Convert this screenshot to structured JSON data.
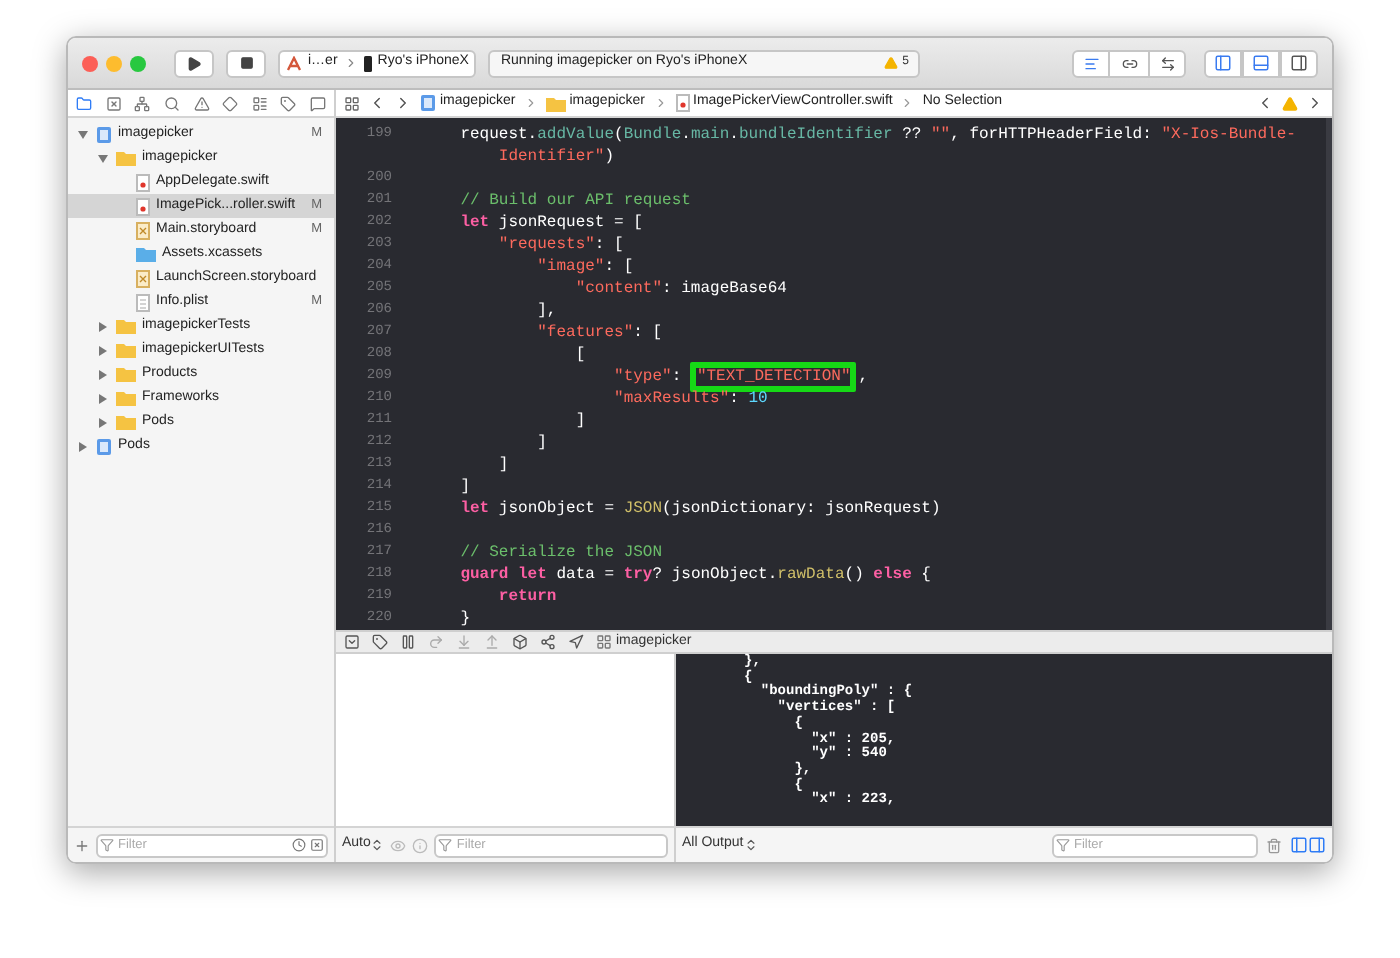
{
  "toolbar": {
    "scheme": {
      "app": "i…er",
      "device": "Ryo's iPhoneX"
    },
    "status": "Running imagepicker on Ryo's iPhoneX",
    "warnings": "5",
    "panels": [
      {
        "kind": "navigator",
        "on": true
      },
      {
        "kind": "debug",
        "on": true
      },
      {
        "kind": "inspector",
        "on": false
      }
    ]
  },
  "navigator_tabs": [
    {
      "kind": "files",
      "selected": true
    },
    {
      "kind": "source",
      "selected": false
    },
    {
      "kind": "symbols",
      "selected": false
    },
    {
      "kind": "search",
      "selected": false
    },
    {
      "kind": "issues",
      "selected": false
    },
    {
      "kind": "tests",
      "selected": false
    },
    {
      "kind": "debug",
      "selected": false
    },
    {
      "kind": "breakpoints",
      "selected": false
    },
    {
      "kind": "reports",
      "selected": false
    }
  ],
  "tree": [
    {
      "label": "imagepicker",
      "kind": "project",
      "status": "M",
      "selected": false,
      "expanded": true,
      "children": [
        {
          "label": "imagepicker",
          "kind": "folder",
          "selected": false,
          "expanded": true,
          "children": [
            {
              "label": "AppDelegate.swift",
              "kind": "swift",
              "selected": false
            },
            {
              "label": "ImagePick...roller.swift",
              "kind": "swift",
              "status": "M",
              "selected": true
            },
            {
              "label": "Main.storyboard",
              "kind": "storyboard",
              "status": "M",
              "selected": false
            },
            {
              "label": "Assets.xcassets",
              "kind": "assets",
              "selected": false
            },
            {
              "label": "LaunchScreen.storyboard",
              "kind": "storyboard",
              "selected": false
            },
            {
              "label": "Info.plist",
              "kind": "plist",
              "status": "M",
              "selected": false
            }
          ]
        },
        {
          "label": "imagepickerTests",
          "kind": "folder",
          "selected": false,
          "expanded": false
        },
        {
          "label": "imagepickerUITests",
          "kind": "folder",
          "selected": false,
          "expanded": false
        },
        {
          "label": "Products",
          "kind": "folder",
          "selected": false,
          "expanded": false
        },
        {
          "label": "Frameworks",
          "kind": "folder",
          "selected": false,
          "expanded": false
        },
        {
          "label": "Pods",
          "kind": "folder",
          "selected": false,
          "expanded": false
        }
      ]
    },
    {
      "label": "Pods",
      "kind": "project",
      "selected": false,
      "expanded": false
    }
  ],
  "sidebar_filter": {
    "placeholder": "Filter"
  },
  "jump_bar": [
    {
      "label": "imagepicker",
      "kind": "project"
    },
    {
      "label": "imagepicker",
      "kind": "folder"
    },
    {
      "label": "ImagePickerViewController.swift",
      "kind": "swift"
    },
    {
      "label": "No Selection",
      "kind": "plain"
    }
  ],
  "code": [
    {
      "number": "199",
      "tokens": [
        {
          "kind": "plain",
          "text": "    request."
        },
        {
          "kind": "call",
          "text": "addValue"
        },
        {
          "kind": "plain",
          "text": "("
        },
        {
          "kind": "call",
          "text": "Bundle"
        },
        {
          "kind": "plain",
          "text": "."
        },
        {
          "kind": "call",
          "text": "main"
        },
        {
          "kind": "plain",
          "text": "."
        },
        {
          "kind": "call",
          "text": "bundleIdentifier"
        },
        {
          "kind": "plain",
          "text": " ?? "
        },
        {
          "kind": "string",
          "text": "\"\""
        },
        {
          "kind": "plain",
          "text": ", forHTTPHeaderField: "
        },
        {
          "kind": "string",
          "text": "\"X-Ios-Bundle-"
        }
      ],
      "continuation": [
        {
          "kind": "string",
          "text": "        Identifier\""
        },
        {
          "kind": "plain",
          "text": ")"
        }
      ]
    },
    {
      "number": "200"
    },
    {
      "number": "201",
      "tokens": [
        {
          "kind": "comment",
          "text": "    // Build our API request"
        }
      ]
    },
    {
      "number": "202",
      "tokens": [
        {
          "kind": "keyword",
          "text": "    let"
        },
        {
          "kind": "plain",
          "text": " jsonRequest = ["
        }
      ]
    },
    {
      "number": "203",
      "tokens": [
        {
          "kind": "string",
          "text": "        \"requests\""
        },
        {
          "kind": "plain",
          "text": ": ["
        }
      ]
    },
    {
      "number": "204",
      "tokens": [
        {
          "kind": "string",
          "text": "            \"image\""
        },
        {
          "kind": "plain",
          "text": ": ["
        }
      ]
    },
    {
      "number": "205",
      "tokens": [
        {
          "kind": "string",
          "text": "                \"content\""
        },
        {
          "kind": "plain",
          "text": ": imageBase64"
        }
      ]
    },
    {
      "number": "206",
      "tokens": [
        {
          "kind": "plain",
          "text": "            ],"
        }
      ]
    },
    {
      "number": "207",
      "tokens": [
        {
          "kind": "string",
          "text": "            \"features\""
        },
        {
          "kind": "plain",
          "text": ": ["
        }
      ]
    },
    {
      "number": "208",
      "tokens": [
        {
          "kind": "plain",
          "text": "                ["
        }
      ]
    },
    {
      "number": "209",
      "tokens": [
        {
          "kind": "string",
          "text": "                    \"type\""
        },
        {
          "kind": "plain",
          "text": ": "
        },
        {
          "kind": "string",
          "text": "\"TEXT_DETECTION\"",
          "boxed": true
        },
        {
          "kind": "plain",
          "text": ","
        }
      ]
    },
    {
      "number": "210",
      "tokens": [
        {
          "kind": "string",
          "text": "                    \"maxResults\""
        },
        {
          "kind": "plain",
          "text": ": "
        },
        {
          "kind": "number",
          "text": "10"
        }
      ]
    },
    {
      "number": "211",
      "tokens": [
        {
          "kind": "plain",
          "text": "                ]"
        }
      ]
    },
    {
      "number": "212",
      "tokens": [
        {
          "kind": "plain",
          "text": "            ]"
        }
      ]
    },
    {
      "number": "213",
      "tokens": [
        {
          "kind": "plain",
          "text": "        ]"
        }
      ]
    },
    {
      "number": "214",
      "tokens": [
        {
          "kind": "plain",
          "text": "    ]"
        }
      ]
    },
    {
      "number": "215",
      "tokens": [
        {
          "kind": "keyword",
          "text": "    let"
        },
        {
          "kind": "plain",
          "text": " jsonObject = "
        },
        {
          "kind": "type",
          "text": "JSON"
        },
        {
          "kind": "plain",
          "text": "(jsonDictionary: jsonRequest)"
        }
      ]
    },
    {
      "number": "216"
    },
    {
      "number": "217",
      "tokens": [
        {
          "kind": "comment",
          "text": "    // Serialize the JSON"
        }
      ]
    },
    {
      "number": "218",
      "tokens": [
        {
          "kind": "keyword",
          "text": "    guard let"
        },
        {
          "kind": "plain",
          "text": " data = "
        },
        {
          "kind": "keyword",
          "text": "try"
        },
        {
          "kind": "plain",
          "text": "? jsonObject."
        },
        {
          "kind": "type",
          "text": "rawData"
        },
        {
          "kind": "plain",
          "text": "() "
        },
        {
          "kind": "keyword",
          "text": "else"
        },
        {
          "kind": "plain",
          "text": " {"
        }
      ]
    },
    {
      "number": "219",
      "tokens": [
        {
          "kind": "keyword",
          "text": "        return"
        }
      ]
    },
    {
      "number": "220",
      "tokens": [
        {
          "kind": "plain",
          "text": "    }"
        }
      ]
    }
  ],
  "debug_bar": {
    "process": "imagepicker"
  },
  "console": [
    "},",
    "{",
    "  \"boundingPoly\" : {",
    "    \"vertices\" : [",
    "      {",
    "        \"x\" : 205,",
    "        \"y\" : 540",
    "      },",
    "      {",
    "        \"x\" : 223,"
  ],
  "variables_bar": {
    "scope": "Auto",
    "filter_placeholder": "Filter"
  },
  "console_bar": {
    "scope": "All Output",
    "filter_placeholder": "Filter",
    "panes": [
      {
        "kind": "variables",
        "on": true
      },
      {
        "kind": "console",
        "on": true
      }
    ]
  }
}
